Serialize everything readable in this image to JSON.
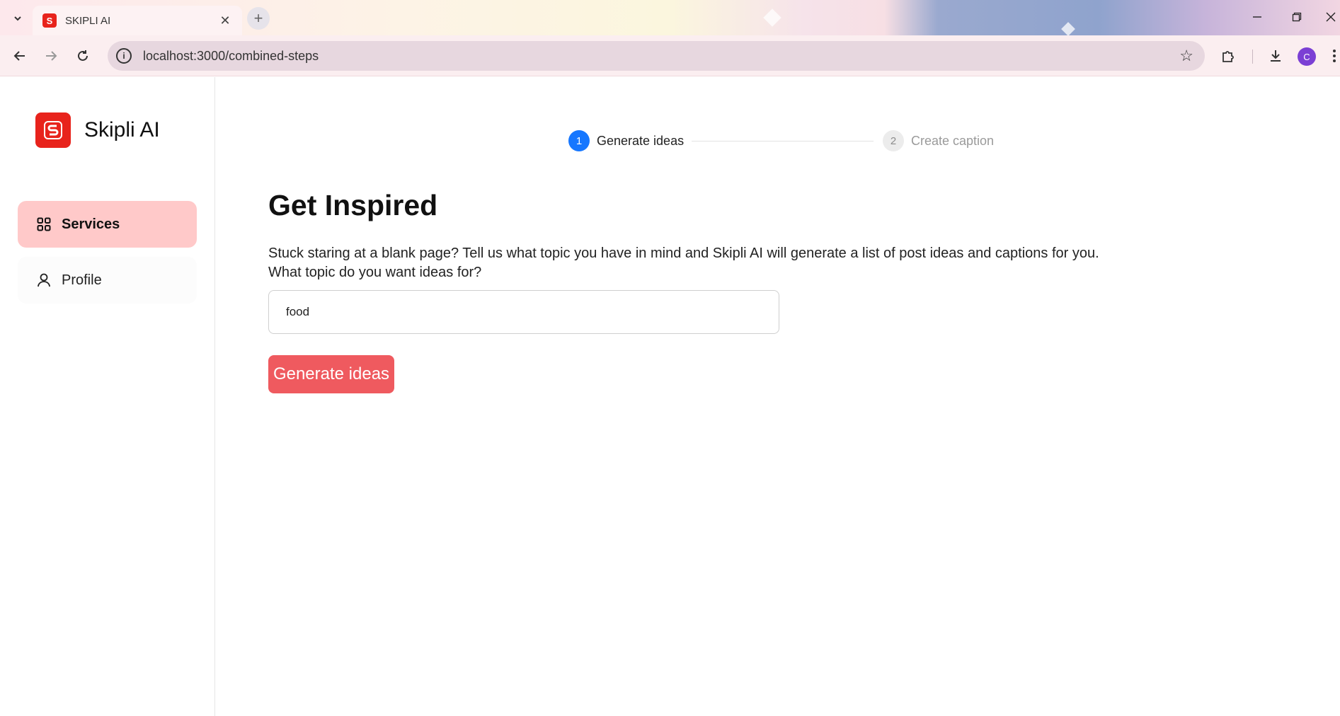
{
  "browser": {
    "tab_title": "SKIPLI AI",
    "url": "localhost:3000/combined-steps",
    "profile_initial": "C"
  },
  "sidebar": {
    "logo_text": "Skipli AI",
    "items": [
      {
        "label": "Services",
        "icon": "grid-icon",
        "active": true
      },
      {
        "label": "Profile",
        "icon": "user-icon",
        "active": false
      }
    ]
  },
  "stepper": {
    "steps": [
      {
        "number": "1",
        "label": "Generate ideas",
        "active": true
      },
      {
        "number": "2",
        "label": "Create caption",
        "active": false
      }
    ]
  },
  "main": {
    "heading": "Get Inspired",
    "description_line1": "Stuck staring at a blank page? Tell us what topic you have in mind and Skipli AI will generate a list of post ideas and captions for you.",
    "description_line2": "What topic do you want ideas for?",
    "topic_value": "food",
    "generate_button": "Generate ideas"
  },
  "colors": {
    "brand": "#e8231c",
    "active_nav_bg": "#ffc9c9",
    "step_active": "#1677ff",
    "button": "#ef5a5f"
  }
}
